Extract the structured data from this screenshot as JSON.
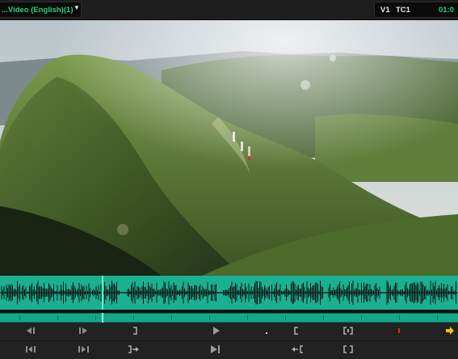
{
  "header": {
    "clip_title": "...Video (English)(1)",
    "dropdown_icon": "triangle-down-icon",
    "track_label": "V1",
    "timecode_label": "TC1",
    "timecode": "01:0"
  },
  "viewer": {
    "content": "video-frame"
  },
  "colors": {
    "accent_green": "#27d07c",
    "waveform_fill": "#1ab092",
    "playhead": "#5ef2c6",
    "mark_yellow": "#f2c200",
    "mark_red": "#c0392b"
  },
  "playback": {
    "playhead_position": 0.224
  },
  "transport": {
    "row1": [
      {
        "name": "step-back-icon"
      },
      {
        "name": "step-forward-icon"
      },
      {
        "name": "mark-out-icon"
      },
      {
        "name": "play-icon"
      },
      {
        "name": "dot-icon"
      },
      {
        "name": "mark-in-icon"
      },
      {
        "name": "mark-clip-icon"
      },
      {
        "name": "red-marker-icon"
      },
      {
        "name": "match-frame-arrow-icon"
      }
    ],
    "row2": [
      {
        "name": "jog-back-icon"
      },
      {
        "name": "jog-forward-icon"
      },
      {
        "name": "go-to-out-icon"
      },
      {
        "name": "play-to-end-icon"
      },
      {
        "name": "go-to-in-icon"
      },
      {
        "name": "clear-marks-icon"
      }
    ]
  }
}
